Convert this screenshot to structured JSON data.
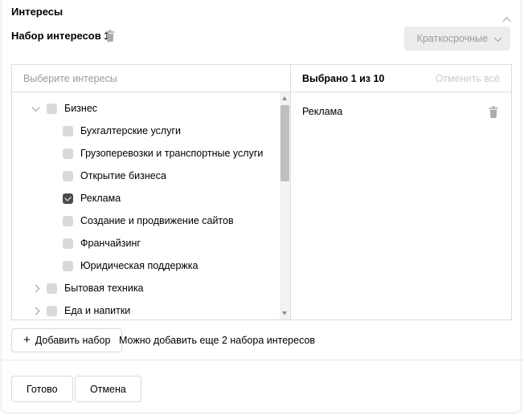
{
  "header": {
    "title": "Интересы"
  },
  "set": {
    "title": "Набор интересов 1",
    "duration": "Краткосрочные"
  },
  "picker": {
    "placeholder_header": "Выберите интересы",
    "selected_header": "Выбрано 1 из 10",
    "clear_all": "Отменить всё",
    "tree": [
      {
        "label": "Бизнес",
        "level": 0,
        "state": "expanded",
        "checked": false
      },
      {
        "label": "Бухгалтерские услуги",
        "level": 1,
        "checked": false
      },
      {
        "label": "Грузоперевозки и транспортные услуги",
        "level": 1,
        "checked": false
      },
      {
        "label": "Открытие бизнеса",
        "level": 1,
        "checked": false
      },
      {
        "label": "Реклама",
        "level": 1,
        "checked": true
      },
      {
        "label": "Создание и продвижение сайтов",
        "level": 1,
        "checked": false
      },
      {
        "label": "Франчайзинг",
        "level": 1,
        "checked": false
      },
      {
        "label": "Юридическая поддержка",
        "level": 1,
        "checked": false
      },
      {
        "label": "Бытовая техника",
        "level": 0,
        "state": "collapsed",
        "checked": false
      },
      {
        "label": "Еда и напитки",
        "level": 0,
        "state": "collapsed",
        "checked": false
      }
    ],
    "selected": [
      {
        "label": "Реклама"
      }
    ]
  },
  "add": {
    "plus": "+",
    "button": "Добавить набор",
    "hint": "Можно добавить еще 2 набора интересов"
  },
  "footer": {
    "done": "Готово",
    "cancel": "Отмена"
  },
  "colors": {
    "checkbox_checked": "#4d4d4d",
    "checkbox_unchecked": "#d9d9d9",
    "muted_text": "#9a9aa0",
    "disabled_link": "#cccad1",
    "border": "#dcdcdc",
    "dropdown_bg": "#ececec"
  }
}
